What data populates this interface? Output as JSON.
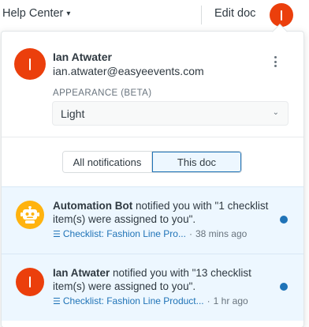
{
  "topbar": {
    "help_center_label": "Help Center",
    "edit_doc_label": "Edit doc"
  },
  "user": {
    "name": "Ian Atwater",
    "email": "ian.atwater@easyeevents.com",
    "appearance_label": "APPEARANCE (BETA)",
    "appearance_value": "Light"
  },
  "filters": {
    "all_label": "All notifications",
    "this_doc_label": "This doc",
    "active": "This doc"
  },
  "notifications": [
    {
      "actor": "Automation Bot",
      "message": " notified you with \"1 checklist item(s) were assigned to you\".",
      "link": "Checklist: Fashion Line Pro...",
      "time": "38 mins ago",
      "avatar": "robot-icon",
      "unread": true
    },
    {
      "actor": "Ian Atwater",
      "message": " notified you with \"13 checklist item(s) were assigned to you\".",
      "link": "Checklist: Fashion Line Product...",
      "time": "1 hr ago",
      "avatar": "user-initial",
      "unread": true
    }
  ],
  "colors": {
    "brand_red": "#eb3f0c",
    "accent_blue": "#1f73b7",
    "unread_bg": "#edf7ff",
    "bot_yellow": "#ffb30f"
  }
}
